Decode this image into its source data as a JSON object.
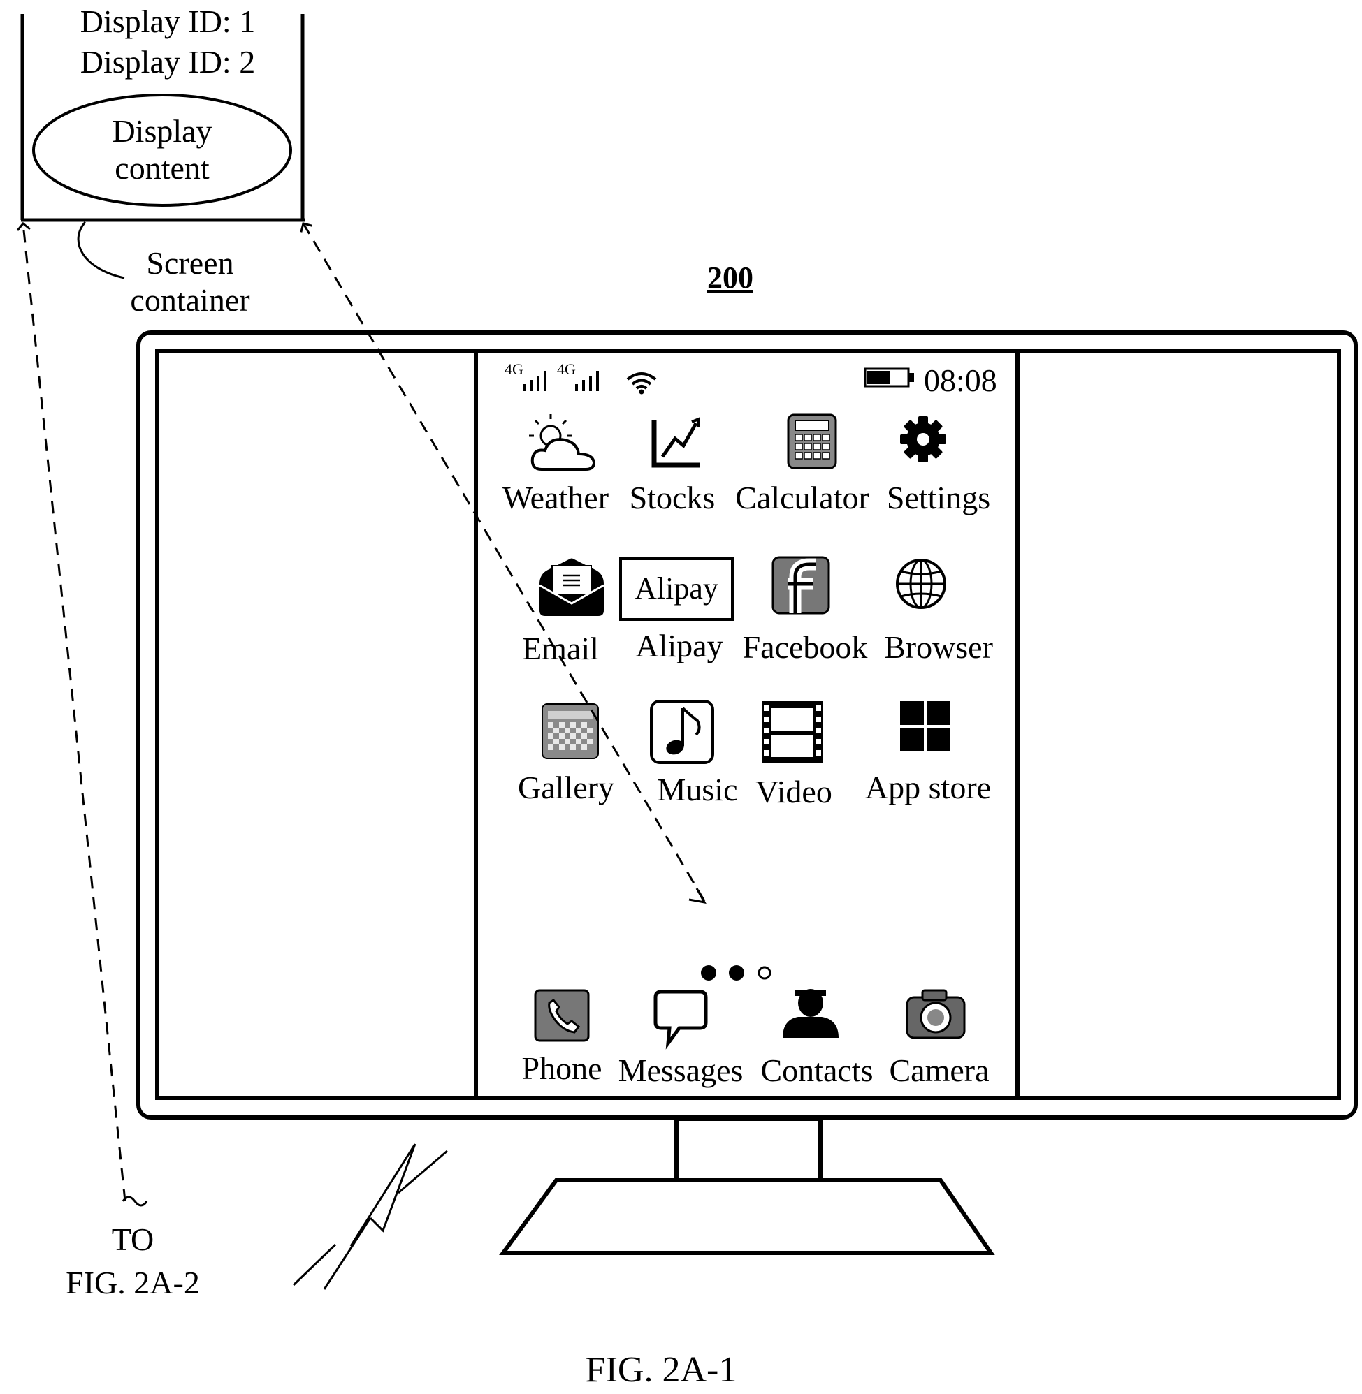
{
  "diagram": {
    "reference_number": "200",
    "figure_caption": "FIG. 2A-1",
    "continuation": {
      "line1": "TO",
      "line2": "FIG. 2A-2"
    },
    "container_box": {
      "display_id_1": "Display ID: 1",
      "display_id_2": "Display ID: 2",
      "ellipse_line1": "Display",
      "ellipse_line2": "content",
      "caption_line1": "Screen",
      "caption_line2": "container"
    }
  },
  "phone": {
    "status_bar": {
      "network_1": "4G",
      "network_2": "4G",
      "time": "08:08",
      "icons": [
        "signal-icon",
        "signal-icon",
        "wifi-icon",
        "battery-icon"
      ]
    },
    "apps": [
      {
        "label": "Weather",
        "icon": "weather-icon"
      },
      {
        "label": "Stocks",
        "icon": "stocks-icon"
      },
      {
        "label": "Calculator",
        "icon": "calculator-icon"
      },
      {
        "label": "Settings",
        "icon": "gear-icon"
      },
      {
        "label": "Email",
        "icon": "email-icon"
      },
      {
        "label": "Alipay",
        "icon": "alipay-icon",
        "icon_text": "Alipay"
      },
      {
        "label": "Facebook",
        "icon": "facebook-icon",
        "icon_text": "f"
      },
      {
        "label": "Browser",
        "icon": "globe-icon"
      },
      {
        "label": "Gallery",
        "icon": "gallery-icon"
      },
      {
        "label": "Music",
        "icon": "music-icon"
      },
      {
        "label": "Video",
        "icon": "film-icon"
      },
      {
        "label": "App store",
        "icon": "app-store-icon"
      }
    ],
    "page_indicator": {
      "count": 3,
      "active": [
        0,
        1
      ]
    },
    "dock": [
      {
        "label": "Phone",
        "icon": "phone-icon"
      },
      {
        "label": "Messages",
        "icon": "messages-icon"
      },
      {
        "label": "Contacts",
        "icon": "contacts-icon"
      },
      {
        "label": "Camera",
        "icon": "camera-icon"
      }
    ]
  }
}
